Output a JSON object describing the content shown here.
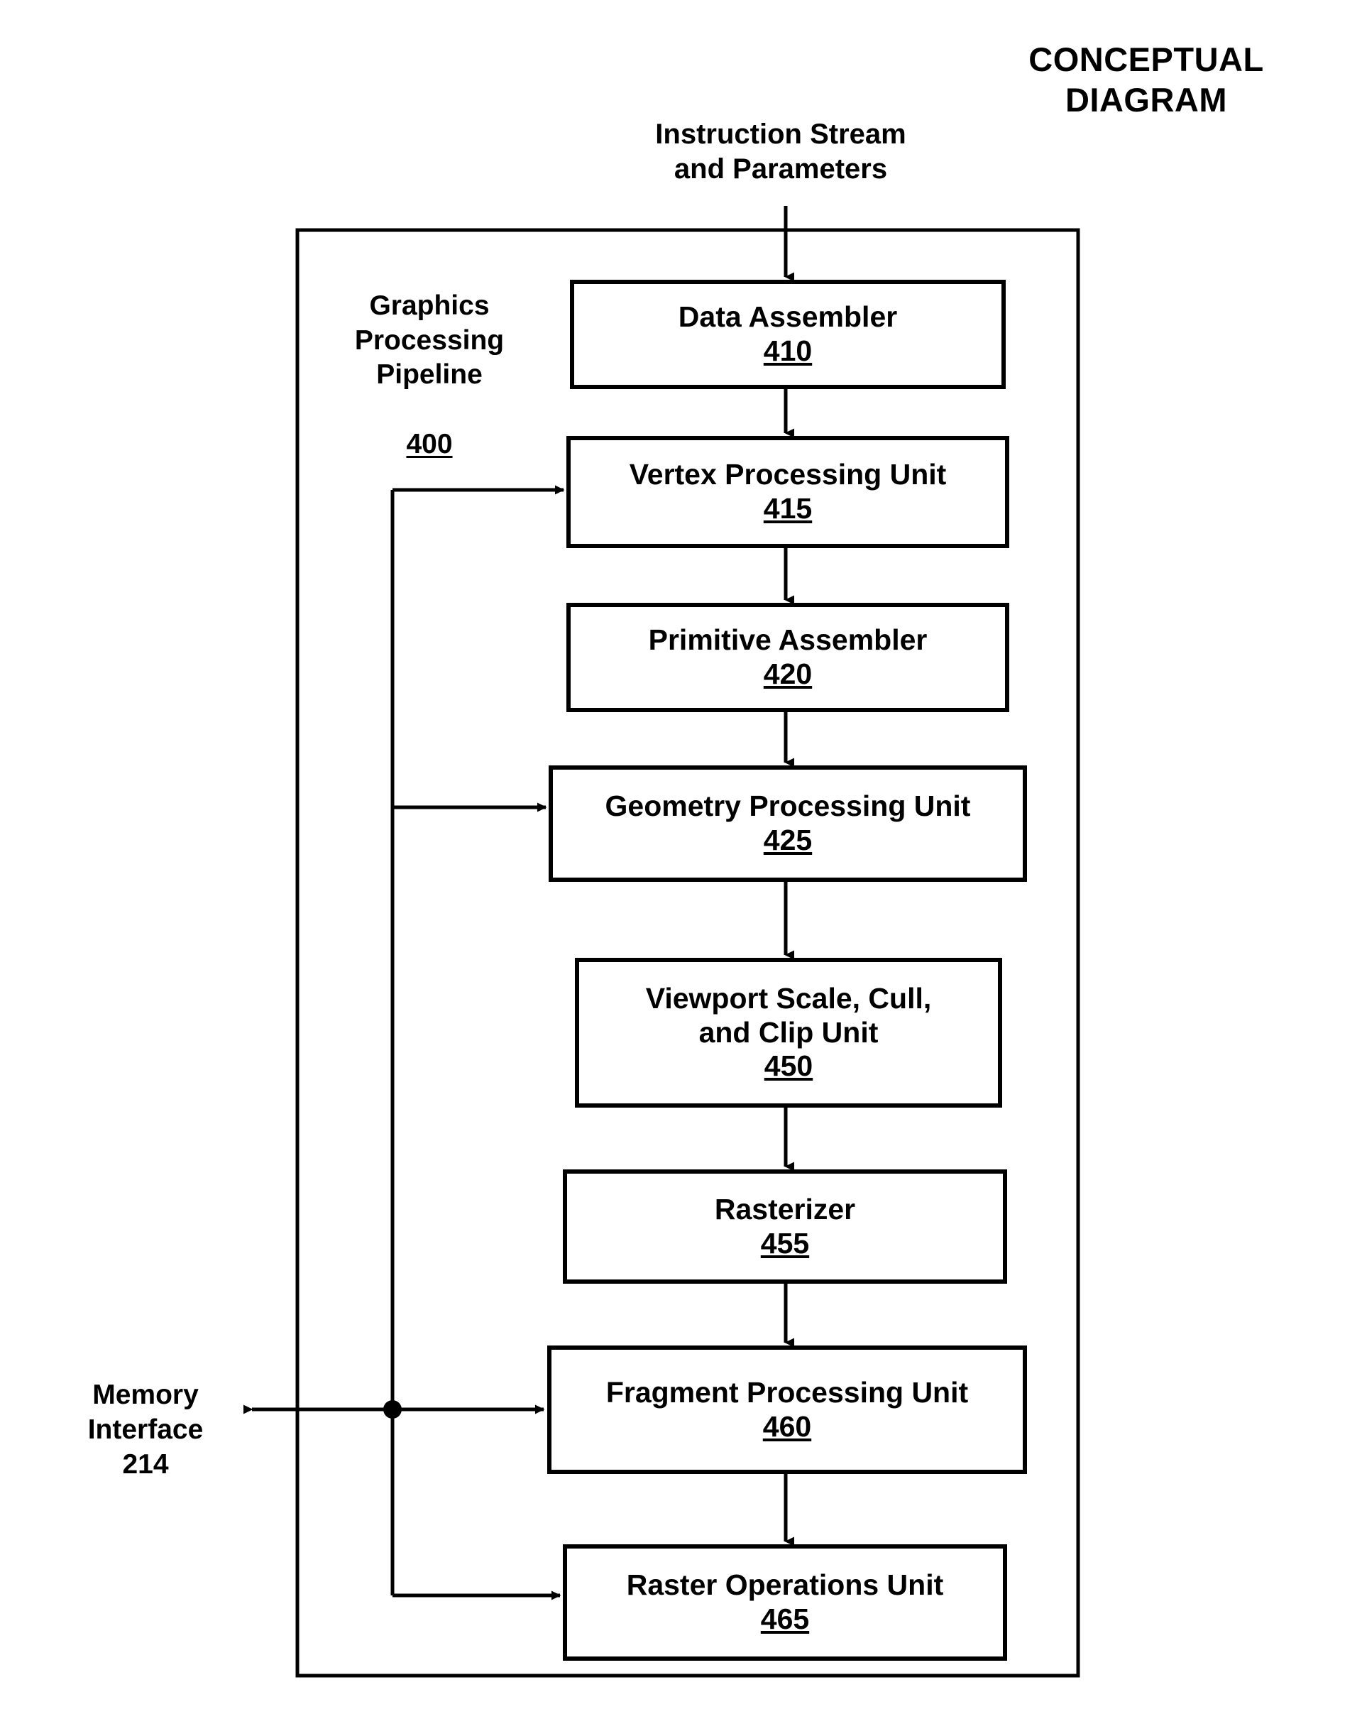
{
  "figure": {
    "heading": "CONCEPTUAL\nDIAGRAM",
    "input_label": "Instruction Stream\nand Parameters",
    "container": {
      "name": "Graphics\nProcessing\nPipeline",
      "ref": "400"
    },
    "external": {
      "memory_interface": "Memory\nInterface\n214"
    },
    "stages": [
      {
        "name": "Data Assembler",
        "ref": "410"
      },
      {
        "name": "Vertex Processing Unit",
        "ref": "415"
      },
      {
        "name": "Primitive Assembler",
        "ref": "420"
      },
      {
        "name": "Geometry Processing Unit",
        "ref": "425"
      },
      {
        "name": "Viewport Scale, Cull,\nand Clip Unit",
        "ref": "450"
      },
      {
        "name": "Rasterizer",
        "ref": "455"
      },
      {
        "name": "Fragment Processing Unit",
        "ref": "460"
      },
      {
        "name": "Raster Operations Unit",
        "ref": "465"
      }
    ],
    "colors": {
      "ink": "#000000",
      "paper": "#ffffff"
    }
  }
}
